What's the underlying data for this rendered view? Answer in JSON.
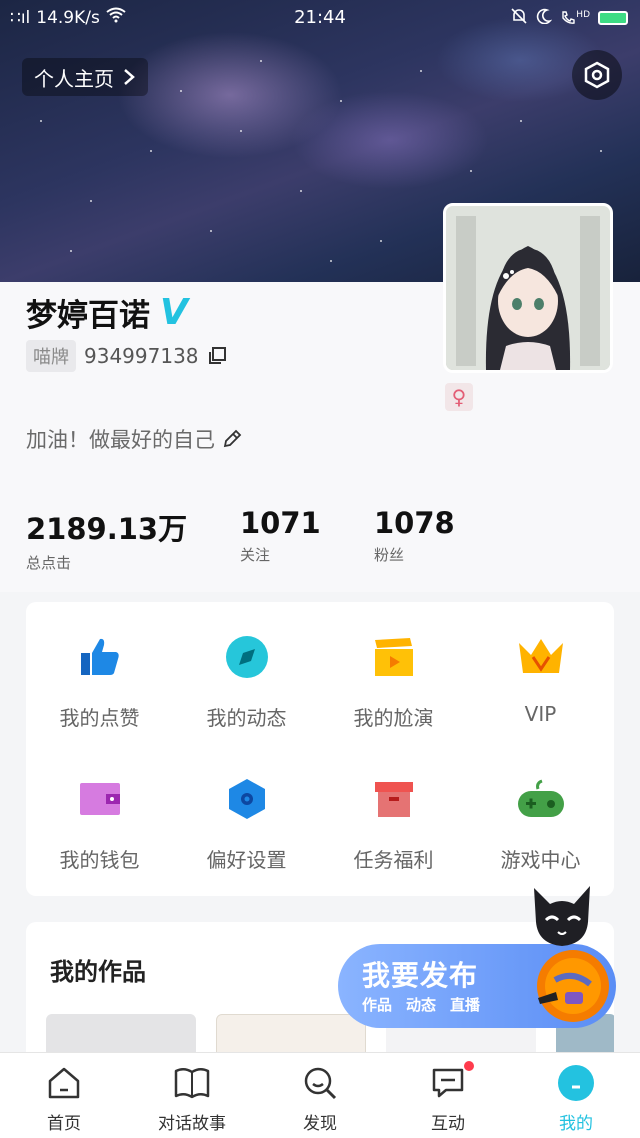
{
  "status_bar": {
    "signal": "∷ıl",
    "speed": "14.9K/s",
    "time": "21:44",
    "right_icons": [
      "bell-mute-icon",
      "moon-icon",
      "phone-hd-icon",
      "battery-icon"
    ],
    "hd_label": "HD"
  },
  "header": {
    "home_link_label": "个人主页",
    "settings_icon": "hexagon-gear-icon"
  },
  "profile": {
    "name": "梦婷百诺",
    "verified_badge": "V",
    "id_tag": "喵牌",
    "id_number": "934997138",
    "gender_symbol": "♀",
    "signature": "加油！做最好的自己"
  },
  "stats": [
    {
      "value": "2189.13万",
      "label": "总点击"
    },
    {
      "value": "1071",
      "label": "关注"
    },
    {
      "value": "1078",
      "label": "粉丝"
    }
  ],
  "menu": [
    {
      "label": "我的点赞",
      "icon": "thumbs-up-icon",
      "color": "#1e88e5"
    },
    {
      "label": "我的动态",
      "icon": "compass-icon",
      "color": "#26c6da"
    },
    {
      "label": "我的尬演",
      "icon": "clapperboard-icon",
      "color": "#ffc107"
    },
    {
      "label": "VIP",
      "icon": "crown-icon",
      "color": "#ffb300"
    },
    {
      "label": "我的钱包",
      "icon": "wallet-icon",
      "color": "#d67be0"
    },
    {
      "label": "偏好设置",
      "icon": "hexagon-settings-icon",
      "color": "#1e88e5"
    },
    {
      "label": "任务福利",
      "icon": "gift-box-icon",
      "color": "#ef5350"
    },
    {
      "label": "游戏中心",
      "icon": "gamepad-icon",
      "color": "#43a047"
    }
  ],
  "works": {
    "title": "我的作品"
  },
  "publish": {
    "label": "我要发布",
    "sub_items": [
      "作品",
      "动态",
      "直播"
    ]
  },
  "bottom_nav": [
    {
      "label": "首页",
      "icon": "home-icon",
      "active": false
    },
    {
      "label": "对话故事",
      "icon": "book-icon",
      "active": false
    },
    {
      "label": "发现",
      "icon": "discover-search-icon",
      "active": false
    },
    {
      "label": "互动",
      "icon": "chat-icon",
      "active": false,
      "badge": true
    },
    {
      "label": "我的",
      "icon": "profile-circle-icon",
      "active": true
    }
  ],
  "colors": {
    "accent": "#23c2e0",
    "badge_red": "#ff3b4d",
    "publish_blue": "#5a8df5"
  }
}
